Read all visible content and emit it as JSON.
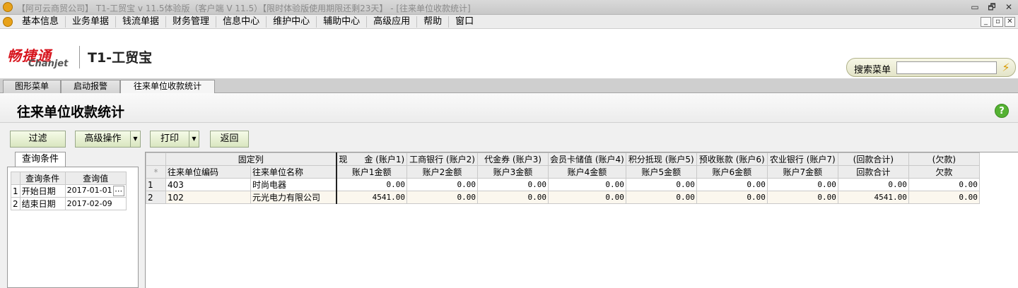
{
  "window": {
    "title": "【阿可云商贸公司】 T1-工贸宝 v 11.5体验版（客户端 V 11.5）【限时体验版使用期限还剩23天】 - [往来单位收款统计]",
    "controls": [
      "▭",
      "🗗",
      "✕"
    ]
  },
  "menu": {
    "items": [
      "基本信息",
      "业务单据",
      "钱流单据",
      "财务管理",
      "信息中心",
      "维护中心",
      "辅助中心",
      "高级应用",
      "帮助",
      "窗口"
    ],
    "mdi_controls": [
      "_",
      "▫",
      "✕"
    ]
  },
  "brand": {
    "logo_cn": "畅捷通",
    "logo_en": "Chanjet",
    "product": "T1-工贸宝"
  },
  "search": {
    "label": "搜索菜单",
    "value": "",
    "go_icon": "⚡"
  },
  "tabs": [
    {
      "label": "图形菜单",
      "active": false
    },
    {
      "label": "启动报警",
      "active": false
    },
    {
      "label": "往来单位收款统计",
      "active": true
    }
  ],
  "page": {
    "title": "往来单位收款统计",
    "help_icon": "?"
  },
  "toolbar": {
    "filter": "过滤",
    "advanced": "高级操作",
    "print": "打印",
    "back": "返回",
    "dropdown_glyph": "▼"
  },
  "query": {
    "tab_label": "查询条件",
    "headers": [
      "查询条件",
      "查询值"
    ],
    "rows": [
      {
        "no": "1",
        "name": "开始日期",
        "value": "2017-01-01",
        "more": "⋯"
      },
      {
        "no": "2",
        "name": "结束日期",
        "value": "2017-02-09",
        "more": ""
      }
    ]
  },
  "grid": {
    "corner": "*",
    "group_headers": [
      "固定列",
      "现　　金 (账户1)",
      "工商银行 (账户2)",
      "代金券 (账户3)",
      "会员卡储值 (账户4)",
      "积分抵现 (账户5)",
      "预收账款 (账户6)",
      "农业银行 (账户7)",
      "(回款合计)",
      "(欠款)"
    ],
    "col_headers": [
      "往来单位编码",
      "往来单位名称",
      "账户1金额",
      "账户2金额",
      "账户3金额",
      "账户4金额",
      "账户5金额",
      "账户6金额",
      "账户7金额",
      "回款合计",
      "欠款"
    ],
    "rows": [
      {
        "no": "1",
        "code": "403",
        "name": "时尚电器",
        "a1": "0.00",
        "a2": "0.00",
        "a3": "0.00",
        "a4": "0.00",
        "a5": "0.00",
        "a6": "0.00",
        "a7": "0.00",
        "total": "0.00",
        "debt": "0.00"
      },
      {
        "no": "2",
        "code": "102",
        "name": "元光电力有限公司",
        "a1": "4541.00",
        "a2": "0.00",
        "a3": "0.00",
        "a4": "0.00",
        "a5": "0.00",
        "a6": "0.00",
        "a7": "0.00",
        "total": "4541.00",
        "debt": "0.00"
      }
    ]
  }
}
